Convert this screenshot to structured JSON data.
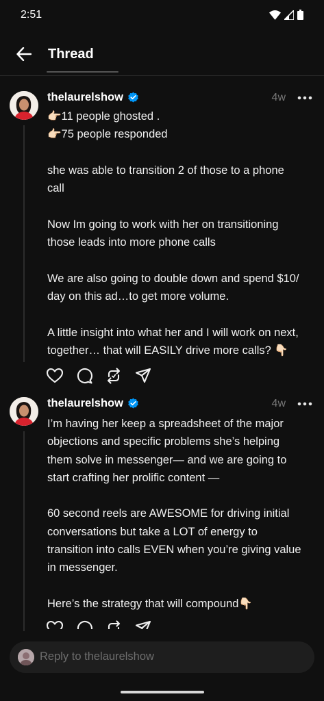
{
  "status_bar": {
    "time": "2:51",
    "icons": [
      "wifi-icon",
      "cellular-signal-icon",
      "battery-icon"
    ]
  },
  "header": {
    "title": "Thread",
    "back_icon": "arrow-left-icon"
  },
  "posts": [
    {
      "author": "thelaurelshow",
      "verified": true,
      "time": "4w",
      "lines": [
        "👉🏻11 people ghosted .",
        "👉🏻75 people responded",
        "",
        "she was able to transition 2 of those to a phone",
        "call",
        "",
        "Now Im going to work with her on transitioning",
        "those leads into more phone calls",
        "",
        "We are also going to double down and spend $10/",
        "day on this ad…to get more volume.",
        "",
        "A little insight into what her and I will work on next,",
        "together… that will EASILY drive more calls? 👇🏻"
      ]
    },
    {
      "author": "thelaurelshow",
      "verified": true,
      "time": "4w",
      "lines": [
        "I’m having her keep a spreadsheet of the major",
        "objections and specific problems she’s helping",
        "them solve in messenger— and we are going to",
        "start crafting her prolific content —",
        "",
        "60 second reels are AWESOME for driving initial",
        "conversations but take a LOT of energy to",
        "transition into calls EVEN when you’re giving value",
        "in messenger.",
        "",
        "Here’s the strategy that will compound👇🏻"
      ]
    }
  ],
  "actions": [
    "heart-icon",
    "comment-icon",
    "repost-icon",
    "share-icon"
  ],
  "reply": {
    "placeholder": "Reply to thelaurelshow"
  },
  "colors": {
    "background": "#101010",
    "verified": "#0095f6",
    "muted": "#777777"
  }
}
